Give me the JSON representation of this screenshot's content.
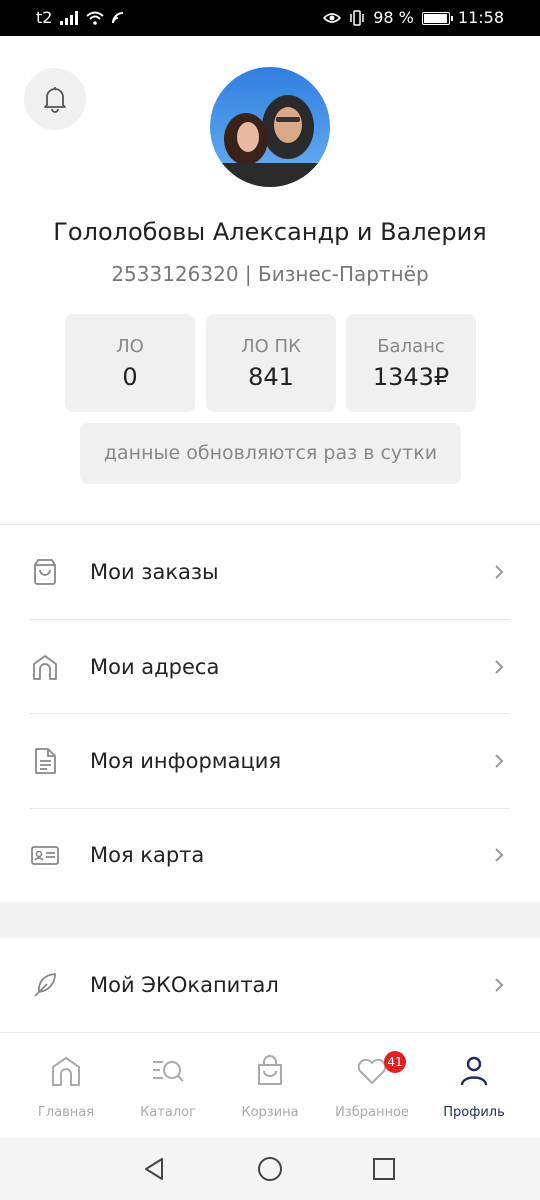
{
  "status_bar": {
    "carrier": "t2",
    "battery": "98 %",
    "time": "11:58"
  },
  "profile": {
    "name": "Гололобовы Александр и Валерия",
    "subtitle": "2533126320 | Бизнес-Партнёр",
    "stats": [
      {
        "label": "ЛО",
        "value": "0"
      },
      {
        "label": "ЛО ПК",
        "value": "841"
      },
      {
        "label": "Баланс",
        "value": "1343₽"
      }
    ],
    "update_note": "данные обновляются раз в сутки"
  },
  "menu": {
    "items": [
      {
        "label": "Мои заказы",
        "icon": "bag-icon"
      },
      {
        "label": "Мои адреса",
        "icon": "home-icon"
      },
      {
        "label": "Моя информация",
        "icon": "document-icon"
      },
      {
        "label": "Моя карта",
        "icon": "id-card-icon"
      },
      {
        "label": "Мой ЭКОкапитал",
        "icon": "feather-icon"
      }
    ]
  },
  "tabbar": {
    "tabs": [
      {
        "label": "Главная",
        "icon": "home-icon"
      },
      {
        "label": "Каталог",
        "icon": "catalog-search-icon"
      },
      {
        "label": "Корзина",
        "icon": "bag-icon"
      },
      {
        "label": "Избранное",
        "icon": "heart-icon",
        "badge": "41"
      },
      {
        "label": "Профиль",
        "icon": "person-icon",
        "active": true
      }
    ]
  },
  "colors": {
    "accent": "#1f2e5c",
    "badge": "#e02020",
    "muted": "#aaaaaa"
  }
}
